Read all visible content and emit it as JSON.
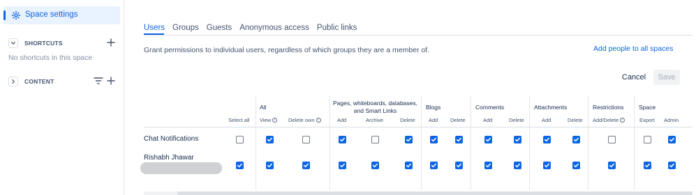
{
  "sidebar": {
    "active_item": "Space settings",
    "shortcuts": {
      "label": "SHORTCUTS",
      "empty": "No shortcuts in this space"
    },
    "content": {
      "label": "CONTENT"
    }
  },
  "tabs": [
    "Users",
    "Groups",
    "Guests",
    "Anonymous access",
    "Public links"
  ],
  "description": "Grant permissions to individual users, regardless of which groups they are a member of.",
  "add_all_label": "Add people to all spaces",
  "cancel_label": "Cancel",
  "save_label": "Save",
  "columns": {
    "groups": [
      "All",
      "Pages, whiteboards, databases, and Smart Links",
      "Blogs",
      "Comments",
      "Attachments",
      "Restrictions",
      "Space"
    ],
    "subs": [
      "Select all",
      "View",
      "Delete own",
      "Add",
      "Archive",
      "Delete",
      "Add",
      "Delete",
      "Add",
      "Delete",
      "Add",
      "Delete",
      "Add/Delete",
      "Export",
      "Admin"
    ]
  },
  "users": [
    {
      "name": "Chat Notifications",
      "perms": [
        false,
        true,
        false,
        true,
        false,
        true,
        true,
        true,
        true,
        true,
        true,
        true,
        false,
        false,
        true
      ]
    },
    {
      "name": "Rishabh Jhawar",
      "perms": [
        true,
        true,
        true,
        true,
        true,
        true,
        true,
        true,
        true,
        true,
        true,
        true,
        true,
        true,
        true
      ]
    }
  ],
  "colors": {
    "accent": "#0c66e4",
    "text": "#172b4d",
    "muted": "#44546f"
  }
}
